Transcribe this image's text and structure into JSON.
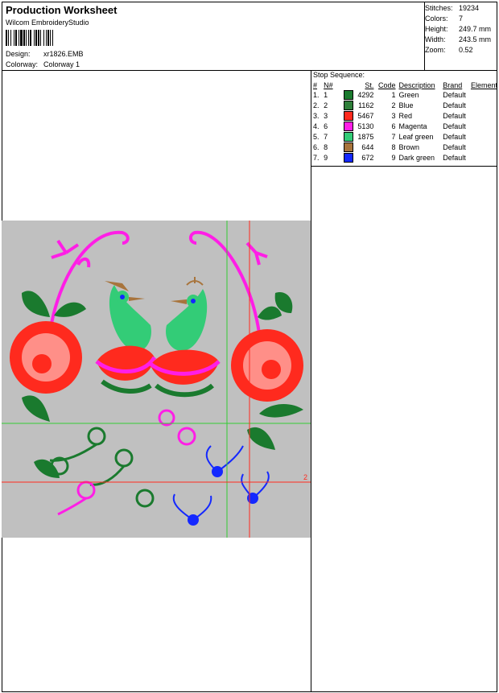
{
  "header": {
    "title": "Production Worksheet",
    "software": "Wilcom EmbroideryStudio",
    "design_label": "Design:",
    "design_value": "xr1826.EMB",
    "colorway_label": "Colorway:",
    "colorway_value": "Colorway 1"
  },
  "stats": [
    {
      "label": "Stitches:",
      "value": "19234"
    },
    {
      "label": "Colors:",
      "value": "7"
    },
    {
      "label": "Height:",
      "value": "249.7 mm"
    },
    {
      "label": "Width:",
      "value": "243.5 mm"
    },
    {
      "label": "Zoom:",
      "value": "0.52"
    }
  ],
  "stop_sequence": {
    "title": "Stop Sequence:",
    "headers": [
      "#",
      "N#",
      "St.",
      "Code",
      "Description",
      "Brand",
      "Element"
    ],
    "rows": [
      {
        "num": "1.",
        "n": "1",
        "color": "#1a7a2e",
        "stitches": "4292",
        "code": "1",
        "desc": "Green",
        "brand": "Default"
      },
      {
        "num": "2.",
        "n": "2",
        "color": "#2f7f3a",
        "stitches": "1162",
        "code": "2",
        "desc": "Blue",
        "brand": "Default"
      },
      {
        "num": "3.",
        "n": "3",
        "color": "#ff2a1e",
        "stitches": "5467",
        "code": "3",
        "desc": "Red",
        "brand": "Default"
      },
      {
        "num": "4.",
        "n": "6",
        "color": "#ff1ee6",
        "stitches": "5130",
        "code": "6",
        "desc": "Magenta",
        "brand": "Default"
      },
      {
        "num": "5.",
        "n": "7",
        "color": "#33cc77",
        "stitches": "1875",
        "code": "7",
        "desc": "Leaf green",
        "brand": "Default"
      },
      {
        "num": "6.",
        "n": "8",
        "color": "#a8743c",
        "stitches": "644",
        "code": "8",
        "desc": "Brown",
        "brand": "Default"
      },
      {
        "num": "7.",
        "n": "9",
        "color": "#1428ff",
        "stitches": "672",
        "code": "9",
        "desc": "Dark green",
        "brand": "Default"
      }
    ]
  },
  "canvas": {
    "background": "#c0c0c0",
    "guide_marker": "2"
  }
}
